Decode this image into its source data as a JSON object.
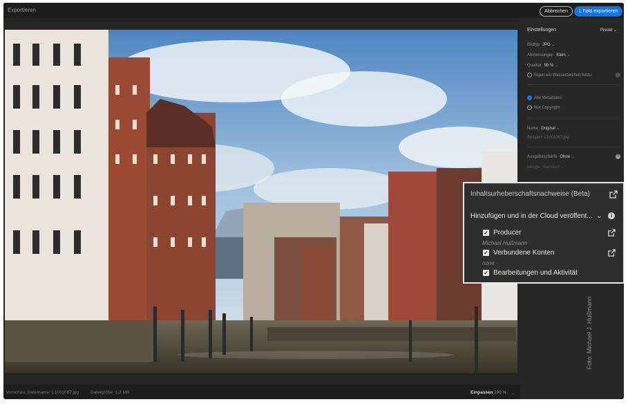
{
  "window": {
    "title": "Exportieren"
  },
  "toolbar": {
    "cancel_label": "Abbrechen",
    "export_label": "1 Foto exportieren"
  },
  "status": {
    "preview": "Vorschau, Dateiname: L1001067.jpg",
    "filesize": "Dateigröße: 1,2 MB",
    "fit_label": "Einpassen",
    "zoom": "100 %"
  },
  "settings": {
    "heading": "Einstellungen",
    "preset": "Preset",
    "filetype_label": "Bildtyp",
    "filetype_value": "JPG",
    "size_label": "Abmessungen",
    "size_value": "Klein",
    "quality_label": "Qualität",
    "quality_value": "90 %",
    "watermark_label": "Eigen ein Wasserzeichen hinzu",
    "metadata_all": "Alle Metadaten",
    "metadata_copyright": "Nur Copyright",
    "name_label": "Name",
    "name_value": "Original",
    "name_example": "Beispiel: L1001067.jpg",
    "sharpen_label": "Ausgabeschärfe",
    "sharpen_value": "Ohne",
    "amount_label": "Menge",
    "amount_value": "Standard"
  },
  "photo_credit": "Foto: Michael J. Hußmann",
  "credentials": {
    "title": "Inhaltsurheberschaftsnachweise (Beta)",
    "dropdown_value": "Hinzufügen und in der Cloud veröffent...",
    "items": [
      {
        "label": "Producer",
        "sub": "Michael Hußmann"
      },
      {
        "label": "Verbundene Konten",
        "sub": "none"
      },
      {
        "label": "Bearbeitungen und Aktivität"
      }
    ]
  },
  "colors": {
    "accent": "#1473e6",
    "panel": "#272727",
    "popup": "#2e2e2e"
  }
}
